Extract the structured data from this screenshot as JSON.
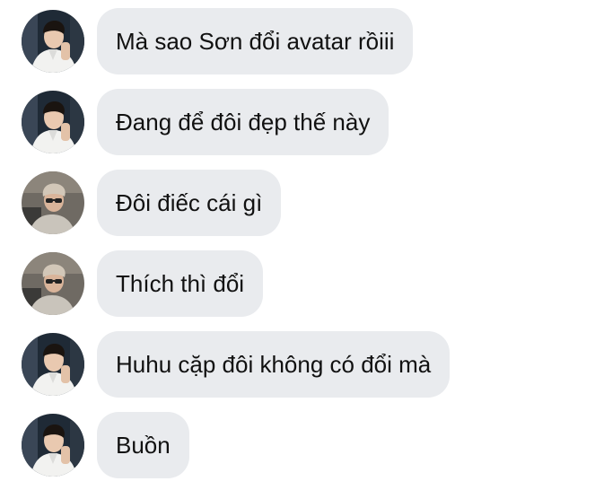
{
  "chat": {
    "messages": [
      {
        "sender_avatar": "avatar-man-white-shirt",
        "text": "Mà sao Sơn đổi avatar rồiii"
      },
      {
        "sender_avatar": "avatar-man-white-shirt",
        "text": "Đang để đôi đẹp thế này"
      },
      {
        "sender_avatar": "avatar-man-glasses-car",
        "text": "Đôi điếc cái gì"
      },
      {
        "sender_avatar": "avatar-man-glasses-car",
        "text": "Thích thì đổi"
      },
      {
        "sender_avatar": "avatar-man-white-shirt",
        "text": "Huhu cặp đôi không có đổi mà"
      },
      {
        "sender_avatar": "avatar-man-white-shirt",
        "text": "Buồn"
      }
    ]
  },
  "colors": {
    "bubble_background": "#e9ebee",
    "text": "#111111",
    "page_background": "#ffffff"
  }
}
